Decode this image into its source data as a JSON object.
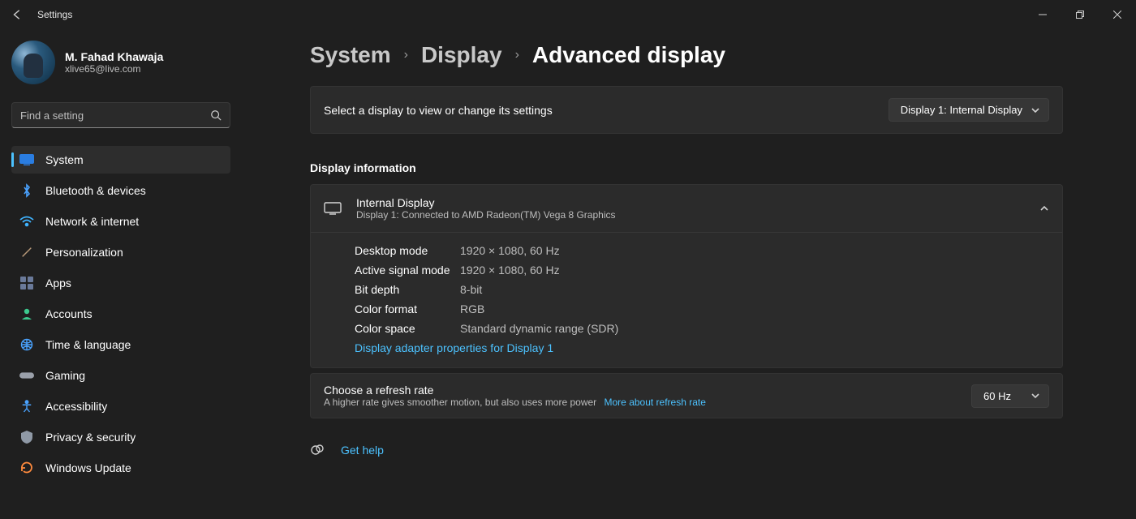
{
  "window": {
    "title": "Settings"
  },
  "profile": {
    "name": "M. Fahad Khawaja",
    "email": "xlive65@live.com"
  },
  "search": {
    "placeholder": "Find a setting"
  },
  "nav": [
    {
      "label": "System"
    },
    {
      "label": "Bluetooth & devices"
    },
    {
      "label": "Network & internet"
    },
    {
      "label": "Personalization"
    },
    {
      "label": "Apps"
    },
    {
      "label": "Accounts"
    },
    {
      "label": "Time & language"
    },
    {
      "label": "Gaming"
    },
    {
      "label": "Accessibility"
    },
    {
      "label": "Privacy & security"
    },
    {
      "label": "Windows Update"
    }
  ],
  "crumbs": {
    "l0": "System",
    "l1": "Display",
    "l2": "Advanced display"
  },
  "selector": {
    "hint": "Select a display to view or change its settings",
    "value": "Display 1: Internal Display"
  },
  "section_title": "Display information",
  "display": {
    "name": "Internal Display",
    "sub": "Display 1: Connected to AMD Radeon(TM) Vega 8 Graphics",
    "props": {
      "desktop_mode_k": "Desktop mode",
      "desktop_mode_v": "1920 × 1080, 60 Hz",
      "active_signal_k": "Active signal mode",
      "active_signal_v": "1920 × 1080, 60 Hz",
      "bit_depth_k": "Bit depth",
      "bit_depth_v": "8-bit",
      "color_format_k": "Color format",
      "color_format_v": "RGB",
      "color_space_k": "Color space",
      "color_space_v": "Standard dynamic range (SDR)"
    },
    "adapter_link": "Display adapter properties for Display 1"
  },
  "refresh": {
    "title": "Choose a refresh rate",
    "sub": "A higher rate gives smoother motion, but also uses more power",
    "more": "More about refresh rate",
    "value": "60 Hz"
  },
  "help": {
    "label": "Get help"
  }
}
